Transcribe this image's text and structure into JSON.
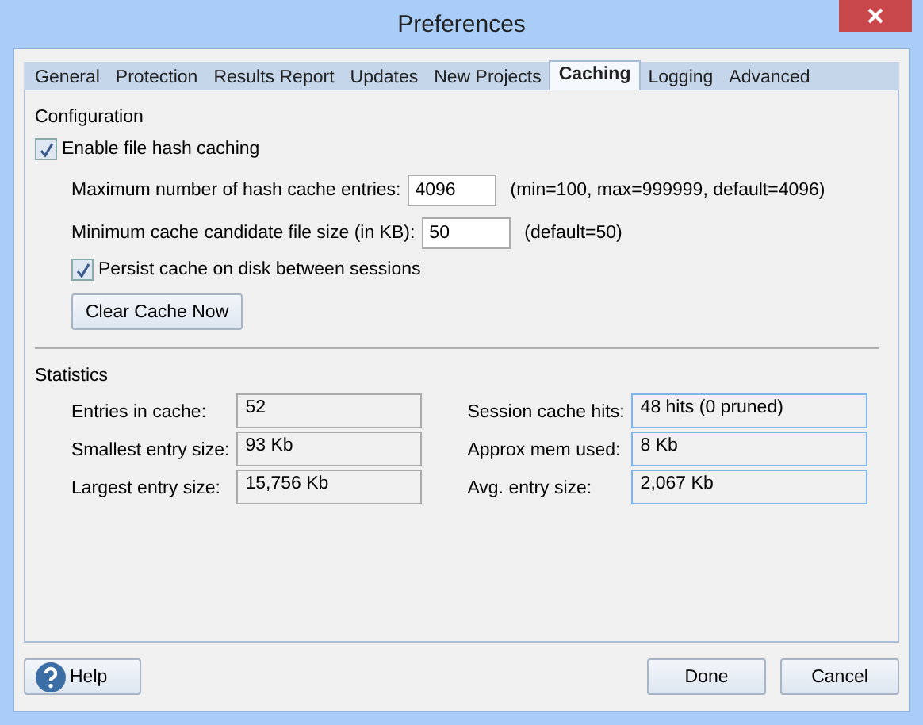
{
  "window": {
    "title": "Preferences"
  },
  "tabs": [
    {
      "label": "General",
      "selected": false
    },
    {
      "label": "Protection",
      "selected": false
    },
    {
      "label": "Results Report",
      "selected": false
    },
    {
      "label": "Updates",
      "selected": false
    },
    {
      "label": "New Projects",
      "selected": false
    },
    {
      "label": "Caching",
      "selected": true
    },
    {
      "label": "Logging",
      "selected": false
    },
    {
      "label": "Advanced",
      "selected": false
    }
  ],
  "configuration": {
    "heading": "Configuration",
    "enable": {
      "label": "Enable file hash caching",
      "checked": true
    },
    "fields": [
      {
        "label": "Maximum number of hash cache entries:",
        "value": "4096",
        "hint": "(min=100, max=999999, default=4096)"
      },
      {
        "label": "Minimum cache candidate file size (in KB):",
        "value": "50",
        "hint": "(default=50)"
      }
    ],
    "persist": {
      "label": "Persist cache on disk between sessions",
      "checked": true
    },
    "clear_button": "Clear Cache Now"
  },
  "statistics": {
    "heading": "Statistics",
    "left": [
      {
        "label": "Entries in cache:",
        "value": "52"
      },
      {
        "label": "Smallest entry size:",
        "value": "93 Kb"
      },
      {
        "label": "Largest entry size:",
        "value": "15,756 Kb"
      }
    ],
    "right": [
      {
        "label": "Session cache hits:",
        "value": "48 hits (0 pruned)"
      },
      {
        "label": "Approx mem used:",
        "value": "8 Kb"
      },
      {
        "label": "Avg. entry size:",
        "value": "2,067 Kb"
      }
    ]
  },
  "buttons": {
    "help": "Help",
    "done": "Done",
    "cancel": "Cancel"
  }
}
